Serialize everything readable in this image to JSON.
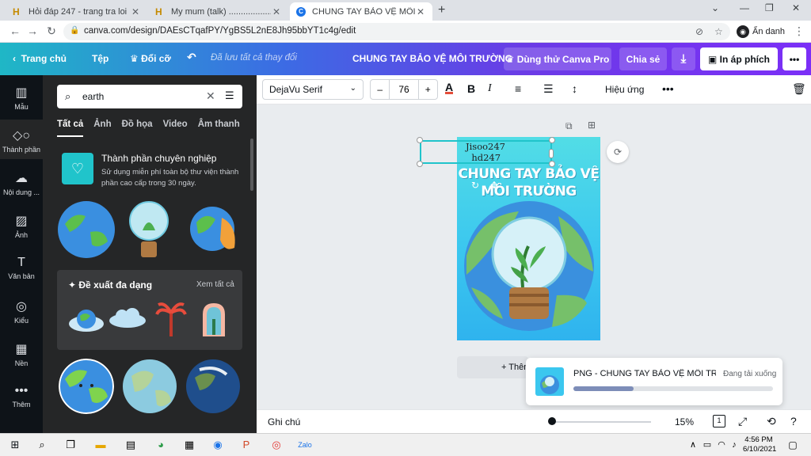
{
  "browser": {
    "tabs": [
      {
        "title": "Hỏi đáp 247 - trang tra loi",
        "favicon": "H"
      },
      {
        "title": "My mum (talk) ..........................",
        "favicon": "H"
      },
      {
        "title": "CHUNG TAY BẢO VỆ MÔI TRƯỜNG",
        "favicon": "C"
      }
    ],
    "url": "canva.com/design/DAEsCTqafPY/YgBS5L2nE8Jh95bbYT1c4g/edit",
    "profile_label": "Ẩn danh"
  },
  "header": {
    "home": "Trang chủ",
    "file": "Tệp",
    "resize": "Đổi cỡ",
    "saved_status": "Đã lưu tất cả thay đổi",
    "doc_title": "CHUNG TAY BẢO VỆ MÔI TRƯỜNG",
    "try_pro": "Dùng thử Canva Pro",
    "share": "Chia sẻ",
    "print": "In áp phích"
  },
  "rail": [
    {
      "label": "Mẫu",
      "icon": "layout-icon"
    },
    {
      "label": "Thành phần",
      "icon": "shapes-icon"
    },
    {
      "label": "Nội dung ...",
      "icon": "upload-icon"
    },
    {
      "label": "Ảnh",
      "icon": "image-icon"
    },
    {
      "label": "Văn bản",
      "icon": "text-icon"
    },
    {
      "label": "Kiểu",
      "icon": "palette-icon"
    },
    {
      "label": "Nền",
      "icon": "pattern-icon"
    },
    {
      "label": "Thêm",
      "icon": "more-icon"
    }
  ],
  "panel": {
    "search_value": "earth",
    "tabs": [
      "Tất cả",
      "Ảnh",
      "Đồ họa",
      "Video",
      "Âm thanh"
    ],
    "promo_title": "Thành phần chuyên nghiệp",
    "promo_desc": "Sử dụng miễn phí toàn bộ thư viện thành phần cao cấp trong 30 ngày.",
    "recommend_title": "Đề xuất đa dạng",
    "see_all": "Xem tất cả"
  },
  "toolbar": {
    "font": "DejaVu Serif",
    "font_size": "76",
    "effects": "Hiệu ứng"
  },
  "design": {
    "title_line1": "CHUNG TAY BẢO VỆ",
    "title_line2": "MÔI TRƯỜNG",
    "watermark_line1": "Jisoo247",
    "watermark_line2": "hd247",
    "add_page": "+ Thêm"
  },
  "toast": {
    "filename": "PNG - CHUNG TAY BẢO VỆ MÔI TRƯ...",
    "status": "Đang tải xuống",
    "progress_fraction": 0.3
  },
  "bottombar": {
    "notes": "Ghi chú",
    "zoom": "15%",
    "page_num": "1"
  },
  "taskbar": {
    "time": "4:56 PM",
    "date": "6/10/2021"
  },
  "colors": {
    "rail_bg": "#0e1318",
    "panel_bg": "#252627",
    "accent": "#20c4cb",
    "header_purple": "#7b2ff7"
  }
}
